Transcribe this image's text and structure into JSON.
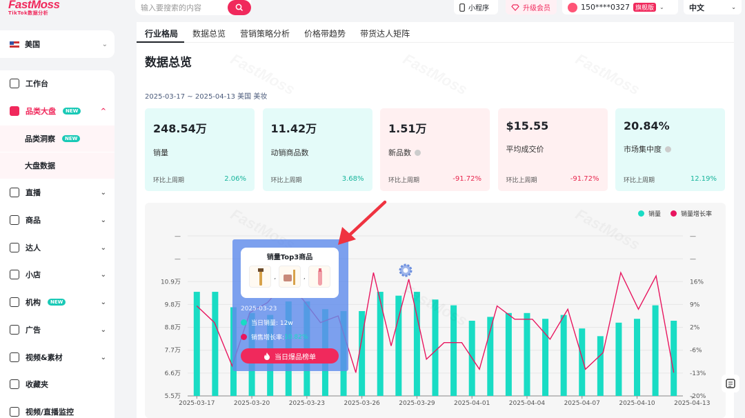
{
  "header": {
    "logo_main": "FastMoss",
    "logo_sub": "TikTok数据分析",
    "search_placeholder": "输入要搜索的内容",
    "mini_program": "小程序",
    "upgrade": "升级会员",
    "phone": "150****0327",
    "plan_badge": "旗舰版",
    "language": "中文"
  },
  "sidebar": {
    "country": "美国",
    "items": [
      {
        "label": "工作台",
        "icon": "home-icon"
      },
      {
        "label": "品类大盘",
        "icon": "bar-chart-icon",
        "badge": "NEW",
        "active": true,
        "chev": "^"
      },
      {
        "label": "品类洞察",
        "badge": "NEW",
        "sub": true
      },
      {
        "label": "大盘数据",
        "sub": true
      },
      {
        "label": "直播",
        "icon": "live-icon",
        "chev": "⌄"
      },
      {
        "label": "商品",
        "icon": "bag-icon",
        "chev": "⌄"
      },
      {
        "label": "达人",
        "icon": "star-user-icon",
        "chev": "⌄"
      },
      {
        "label": "小店",
        "icon": "store-icon",
        "chev": "⌄"
      },
      {
        "label": "机构",
        "icon": "org-icon",
        "badge": "NEW",
        "chev": "⌄"
      },
      {
        "label": "广告",
        "icon": "ad-icon",
        "chev": "⌄"
      },
      {
        "label": "视频&素材",
        "icon": "video-icon",
        "chev": "⌄"
      },
      {
        "label": "收藏夹",
        "icon": "star-icon"
      },
      {
        "label": "视频/直播监控",
        "icon": "monitor-icon"
      }
    ]
  },
  "tabs": [
    "行业格局",
    "数据总览",
    "营销策略分析",
    "价格带趋势",
    "带货达人矩阵"
  ],
  "page_title": "数据总览",
  "range": "2025-03-17 ~ 2025-04-13   美国   美妆",
  "cards": [
    {
      "value": "248.54万",
      "label": "销量",
      "foot": "环比上周期",
      "change": "2.06%",
      "dir": "up",
      "tone": "g",
      "info": false
    },
    {
      "value": "11.42万",
      "label": "动销商品数",
      "foot": "环比上周期",
      "change": "3.68%",
      "dir": "up",
      "tone": "g",
      "info": false
    },
    {
      "value": "1.51万",
      "label": "新品数",
      "foot": "环比上周期",
      "change": "-91.72%",
      "dir": "dn",
      "tone": "p",
      "info": true
    },
    {
      "value": "$15.55",
      "label": "平均成交价",
      "foot": "环比上周期",
      "change": "-91.72%",
      "dir": "dn",
      "tone": "p",
      "info": false
    },
    {
      "value": "20.84%",
      "label": "市场集中度",
      "foot": "环比上周期",
      "change": "12.19%",
      "dir": "up",
      "tone": "g",
      "info": true
    }
  ],
  "legend": {
    "sales": "销量",
    "growth": "销量增长率"
  },
  "colors": {
    "bar": "#19dcc4",
    "line": "#e8165f",
    "accent": "#f0295c"
  },
  "chart_data": {
    "type": "bar",
    "x_ticks": [
      "2025-03-17",
      "2025-03-20",
      "2025-03-23",
      "2025-03-26",
      "2025-03-29",
      "2025-04-01",
      "2025-04-04",
      "2025-04-07",
      "2025-04-10",
      "2025-04-13"
    ],
    "y_left_ticks": [
      "5.5万",
      "6.6万",
      "7.7万",
      "8.8万",
      "9.8万",
      "10.9万",
      "—",
      "—"
    ],
    "y_right_ticks": [
      "-20%",
      "-13%",
      "-6%",
      "2%",
      "9%",
      "16%",
      "—",
      "—"
    ],
    "y_left_range": [
      5.5,
      13.8
    ],
    "y_right_range": [
      -20,
      28
    ],
    "series": [
      {
        "name": "销量",
        "type": "bar",
        "values": [
          10.9,
          10.9,
          10.1,
          9.8,
          9.7,
          10.4,
          10.4,
          10.0,
          9.9,
          9.9,
          10.9,
          10.7,
          10.9,
          10.5,
          10.2,
          9.4,
          9.6,
          9.8,
          9.8,
          9.5,
          9.7,
          9.0,
          8.6,
          9.3,
          9.5,
          10.2,
          9.4
        ]
      },
      {
        "name": "销量增长率",
        "type": "line",
        "values": [
          7,
          2,
          -11,
          5,
          8,
          14,
          9,
          2,
          4,
          -13,
          17,
          -5,
          15,
          -9,
          -4,
          -4,
          -12,
          7,
          3,
          3,
          -3,
          6,
          -12,
          -7,
          17,
          6,
          16,
          -13
        ]
      }
    ]
  },
  "tooltip": {
    "title": "销量Top3商品",
    "sep": ",",
    "date": "2025-03-23",
    "sales": "当日销量: 12w",
    "growth_label": "销售增长率: ",
    "growth_value": "10.82%",
    "button": "当日爆品榜单"
  }
}
